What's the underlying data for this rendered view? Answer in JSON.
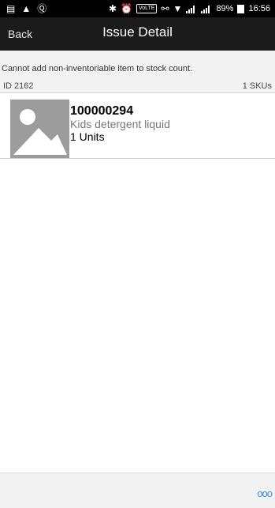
{
  "status_bar": {
    "battery_percent": "89%",
    "time": "16:56",
    "volte_label": "VoLTE"
  },
  "nav": {
    "back_label": "Back",
    "title": "Issue Detail"
  },
  "message": "Cannot add non-inventoriable item to stock count.",
  "summary": {
    "id_label": "ID 2162",
    "sku_count": "1 SKUs"
  },
  "items": [
    {
      "code": "100000294",
      "name": "Kids detergent liquid",
      "units": "1 Units"
    }
  ],
  "bottom_bar": {
    "more_label": "ooo"
  },
  "colors": {
    "nav_background": "#1b1b1b",
    "accent": "#3b8ee8",
    "thumbnail": "#9c9c9c"
  }
}
